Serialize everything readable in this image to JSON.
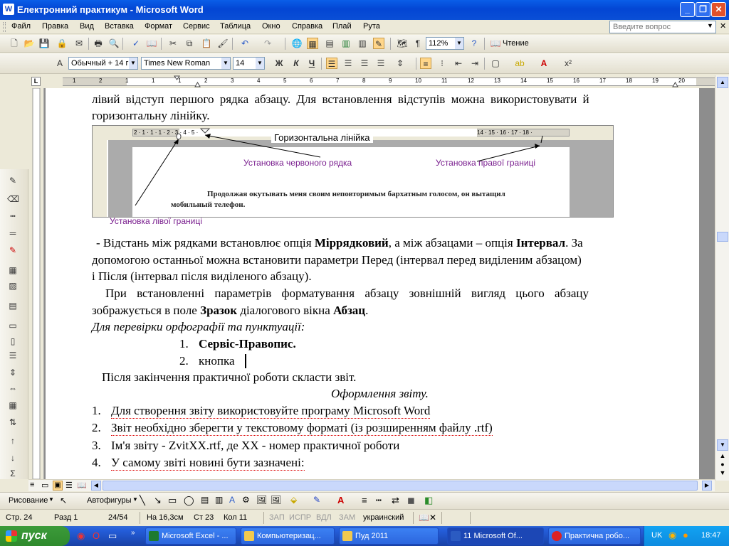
{
  "window": {
    "title": "Електронний практикум - Microsoft Word",
    "min": "_",
    "max": "❐",
    "close": "✕"
  },
  "menu": {
    "items": [
      "Файл",
      "Правка",
      "Вид",
      "Вставка",
      "Формат",
      "Сервис",
      "Таблица",
      "Окно",
      "Справка",
      "Плай",
      "Рута"
    ],
    "ask_placeholder": "Введите вопрос"
  },
  "toolbar": {
    "zoom": "112%",
    "read_label": "Чтение"
  },
  "format": {
    "style": "Обычный + 14 г",
    "font": "Times New Roman",
    "size": "14",
    "bold": "Ж",
    "italic": "К",
    "underline": "Ч"
  },
  "ruler": {
    "tab_marker": "L",
    "numbers": [
      "1",
      "2",
      "1",
      "1",
      "1",
      "2",
      "3",
      "4",
      "5",
      "6",
      "7",
      "8",
      "9",
      "10",
      "11",
      "12",
      "13",
      "14",
      "15",
      "16",
      "17",
      "18",
      "19",
      "20"
    ]
  },
  "document": {
    "p1a": "лівий відступ першого рядка абзацу. Для встановлення відступів можна використовувати й",
    "p1b": "горизонтальну лінійку.",
    "figure": {
      "ruler_label": "Горизонтальна лінійка",
      "red_line": "Установка червоного рядка",
      "right_border": "Установка правої границі",
      "left_border": "Установка лівої границі",
      "sample_line1": "Продолжая окутывать меня своим неповторимым бархатным голосом, он вытащил",
      "sample_line2": "мобильный телефон.",
      "ruler_nums_left": "2 · 1 · 1 · 1 · 2 · 3 · 4 · 5 ·",
      "ruler_nums_right": "14 · 15 · 16 · 17 · 18 ·"
    },
    "p2a_pre": " - Відстань між рядками встановлює опція ",
    "p2a_b1": "Міррядковий",
    "p2a_mid": ", а між абзацами – опція ",
    "p2a_b2": "Інтервал",
    "p2a_post": ". За",
    "p2b": "допомогою останньої можна встановити параметри Перед (інтервал перед виділеним абзацом)",
    "p2c": "і Після (інтервал після виділеного абзацу).",
    "p3a": "При встановленні параметрів форматування абзацу зовнішній вигляд цього абзацу",
    "p3b_pre": "зображується в поле ",
    "p3b_b1": "Зразок",
    "p3b_mid": " діалогового вікна ",
    "p3b_b2": "Абзац",
    "p3b_post": ".",
    "p4": "Для перевірки орфографії та пунктуації:",
    "list1": [
      {
        "num": "1.",
        "text": "Сервіс-Правопис."
      },
      {
        "num": "2.",
        "text": "кнопка"
      }
    ],
    "p5": "Після закінчення  практичної роботи скласти звіт.",
    "heading": "Оформлення звіту.",
    "list2": [
      {
        "num": "1.",
        "text": "Для створення звіту використовуйте програму Microsoft Word"
      },
      {
        "num": "2.",
        "text": "Звіт необхідно зберегти у текстовому форматі (із розширенням файлу .rtf)"
      },
      {
        "num": "3.",
        "text": "Ім'я звіту - ZvitXX.rtf, де XX - номер практичної роботи"
      },
      {
        "num": "4.",
        "text": "У самому звіті новині бути зазначені:"
      }
    ]
  },
  "drawbar": {
    "draw": "Рисование",
    "autoshapes": "Автофигуры"
  },
  "status": {
    "page": "Стр. 24",
    "section": "Разд 1",
    "pages": "24/54",
    "at": "На 16,3см",
    "line": "Ст 23",
    "col": "Кол 11",
    "rec": "ЗАП",
    "trk": "ИСПР",
    "ext": "ВДЛ",
    "ovr": "ЗАМ",
    "lang": "украинский"
  },
  "taskbar": {
    "start": "пуск",
    "tasks": [
      {
        "label": "Microsoft Excel - ...",
        "color": "#1d7a2f"
      },
      {
        "label": "Компьютеризац...",
        "color": "#f1c94e"
      },
      {
        "label": "Пуд 2011",
        "color": "#f1c94e"
      },
      {
        "label": "11 Microsoft Of...",
        "color": "#2b5bc2"
      },
      {
        "label": "Практична робо...",
        "color": "#d22"
      }
    ],
    "lang": "UK",
    "time": "18:47"
  }
}
